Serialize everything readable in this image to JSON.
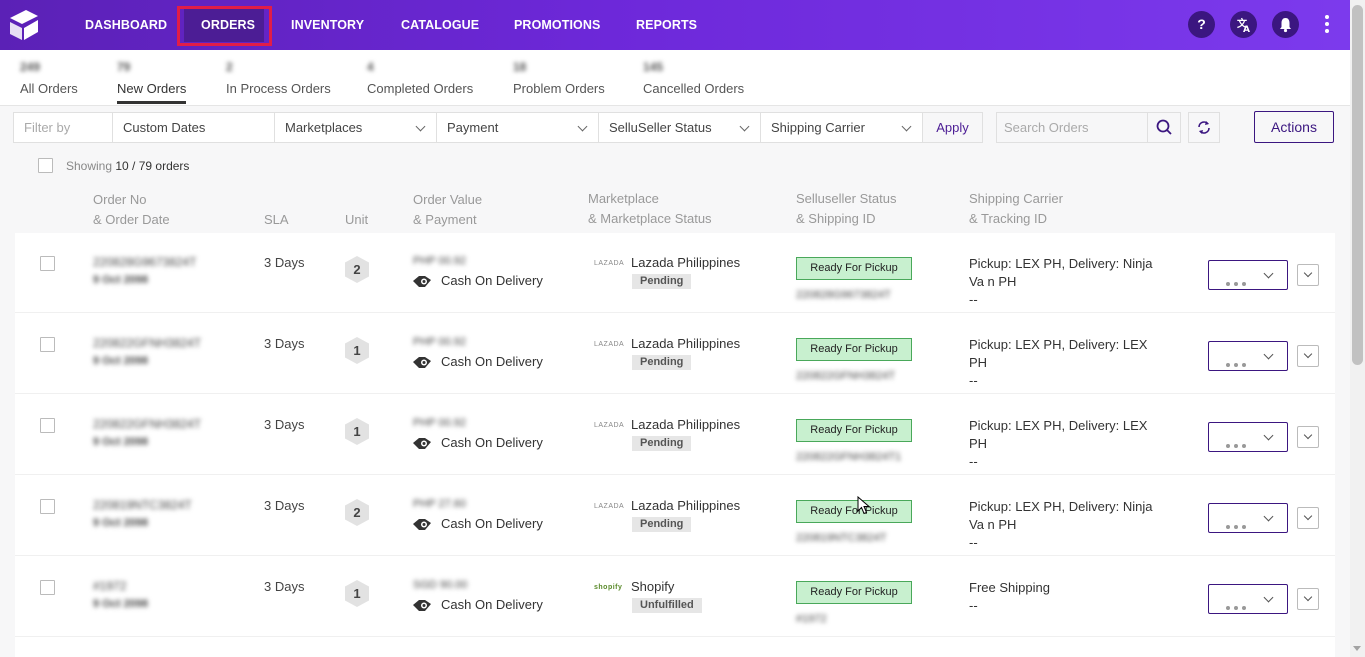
{
  "nav": {
    "items": [
      "DASHBOARD",
      "ORDERS",
      "INVENTORY",
      "CATALOGUE",
      "PROMOTIONS",
      "REPORTS"
    ],
    "active": "ORDERS",
    "icons": [
      "help-icon",
      "translate-icon",
      "bell-icon",
      "kebab-menu-icon"
    ]
  },
  "tabs": [
    {
      "label": "All Orders",
      "count": "249"
    },
    {
      "label": "New Orders",
      "count": "79"
    },
    {
      "label": "In Process Orders",
      "count": "2"
    },
    {
      "label": "Completed Orders",
      "count": "4"
    },
    {
      "label": "Problem Orders",
      "count": "18"
    },
    {
      "label": "Cancelled Orders",
      "count": "145"
    }
  ],
  "filters": {
    "filter_by_placeholder": "Filter by",
    "dates": "Custom Dates",
    "marketplaces": "Marketplaces",
    "payment": "Payment",
    "status": "SelluSeller Status",
    "carrier": "Shipping Carrier",
    "apply": "Apply",
    "search_placeholder": "Search Orders",
    "actions": "Actions"
  },
  "showing": {
    "prefix": "Showing",
    "value": "10 / 79 orders"
  },
  "columns": {
    "order": [
      "Order No",
      "& Order Date"
    ],
    "sla": "SLA",
    "unit": "Unit",
    "value": [
      "Order Value",
      "& Payment"
    ],
    "marketplace": [
      "Marketplace",
      "& Marketplace Status"
    ],
    "status": [
      "Selluseller Status",
      "& Shipping ID"
    ],
    "carrier": [
      "Shipping Carrier",
      "& Tracking ID"
    ]
  },
  "rows": [
    {
      "order_no": "220828G9673824T",
      "date": "9 Oct 2098",
      "sla": "3 Days",
      "unit": "2",
      "value": "PHP 00.92",
      "payment": "Cash On Delivery",
      "mp_logo": "LAZADA",
      "marketplace": "Lazada Philippines",
      "mp_status": "Pending",
      "status": "Ready For Pickup",
      "ship_id": "220828G9673824T",
      "carrier_line": "Pickup: LEX PH, Delivery: Ninja Va n PH",
      "tracking": "--"
    },
    {
      "order_no": "220822GFNH3824T",
      "date": "9 Oct 2098",
      "sla": "3 Days",
      "unit": "1",
      "value": "PHP 00.92",
      "payment": "Cash On Delivery",
      "mp_logo": "LAZADA",
      "marketplace": "Lazada Philippines",
      "mp_status": "Pending",
      "status": "Ready For Pickup",
      "ship_id": "220822GFNH3824T",
      "carrier_line": "Pickup: LEX PH, Delivery: LEX PH",
      "tracking": "--"
    },
    {
      "order_no": "220822GFNH3824T",
      "date": "9 Oct 2098",
      "sla": "3 Days",
      "unit": "1",
      "value": "PHP 00.92",
      "payment": "Cash On Delivery",
      "mp_logo": "LAZADA",
      "marketplace": "Lazada Philippines",
      "mp_status": "Pending",
      "status": "Ready For Pickup",
      "ship_id": "220822GFNH3824T1",
      "carrier_line": "Pickup: LEX PH, Delivery: LEX PH",
      "tracking": "--"
    },
    {
      "order_no": "220819NTC3824T",
      "date": "9 Oct 2098",
      "sla": "3 Days",
      "unit": "2",
      "value": "PHP 27.60",
      "payment": "Cash On Delivery",
      "mp_logo": "LAZADA",
      "marketplace": "Lazada Philippines",
      "mp_status": "Pending",
      "status": "Ready For Pickup",
      "ship_id": "220819NTC3824T",
      "carrier_line": "Pickup: LEX PH, Delivery: Ninja Va n PH",
      "tracking": "--"
    },
    {
      "order_no": "#1972",
      "date": "9 Oct 2098",
      "sla": "3 Days",
      "unit": "1",
      "value": "SGD 90.00",
      "payment": "Cash On Delivery",
      "mp_logo": "shopify",
      "marketplace": "Shopify",
      "mp_status": "Unfulfilled",
      "status": "Ready For Pickup",
      "ship_id": "#1972",
      "carrier_line": "Free Shipping",
      "tracking": "--"
    }
  ],
  "colors": {
    "nav_start": "#5b21b6",
    "nav_end": "#7c3aed",
    "ready_bg": "#c8f0cf",
    "ready_border": "#49a85a",
    "accent": "#3b1680",
    "highlight": "#e11d48"
  }
}
